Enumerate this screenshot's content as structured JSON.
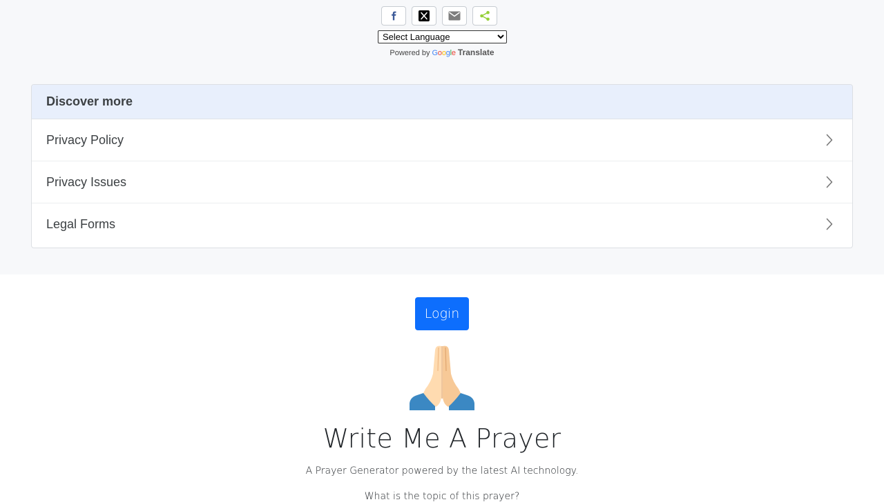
{
  "share": {
    "buttons": [
      {
        "name": "facebook",
        "icon": "facebook-icon",
        "color": "#3b5998"
      },
      {
        "name": "x",
        "icon": "x-icon",
        "color": "#000000"
      },
      {
        "name": "email",
        "icon": "email-icon",
        "color": "#7d7d7d"
      },
      {
        "name": "sharethis",
        "icon": "share-icon",
        "color": "#95d03a"
      }
    ]
  },
  "translate": {
    "select_label": "Select Language",
    "powered_by": "Powered by",
    "google": "Google",
    "translate": "Translate"
  },
  "discover": {
    "title": "Discover more",
    "items": [
      {
        "label": "Privacy Policy"
      },
      {
        "label": "Privacy Issues"
      },
      {
        "label": "Legal Forms"
      }
    ]
  },
  "main": {
    "login_label": "Login",
    "emoji_icon": "folded-hands-icon",
    "title": "Write Me A Prayer",
    "subtitle": "A Prayer Generator powered by the latest AI technology.",
    "topic_prompt": "What is the topic of this prayer?"
  },
  "colors": {
    "accent": "#0d6efd",
    "discover_header_bg": "#e8effc",
    "page_band_bg": "#f7f8fa"
  }
}
